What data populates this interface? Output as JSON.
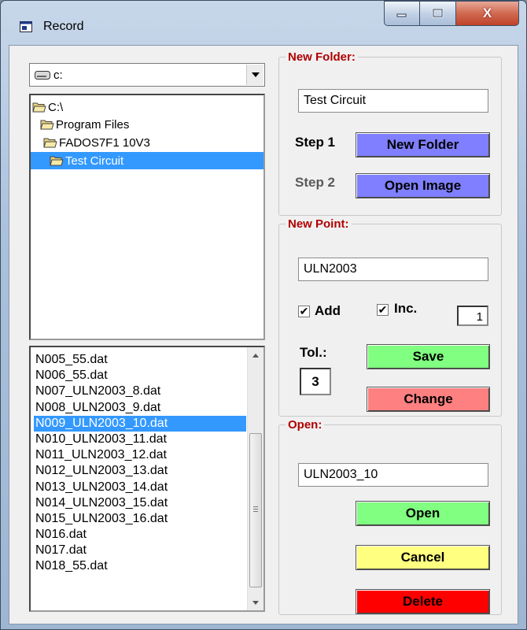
{
  "window": {
    "title": "Record",
    "min_glyph": "–",
    "close_glyph": "X"
  },
  "drive": {
    "value": "c:"
  },
  "tree": {
    "items": [
      "C:\\",
      "Program Files",
      "FADOS7F1 10V3",
      "Test Circuit"
    ],
    "selected": "Test Circuit"
  },
  "files": {
    "items": [
      "N005_55.dat",
      "N006_55.dat",
      "N007_ULN2003_8.dat",
      "N008_ULN2003_9.dat",
      "N009_ULN2003_10.dat",
      "N010_ULN2003_11.dat",
      "N011_ULN2003_12.dat",
      "N012_ULN2003_13.dat",
      "N013_ULN2003_14.dat",
      "N014_ULN2003_15.dat",
      "N015_ULN2003_16.dat",
      "N016.dat",
      "N017.dat",
      "N018_55.dat"
    ],
    "selected": "N009_ULN2003_10.dat"
  },
  "new_folder": {
    "legend": "New Folder:",
    "name_value": "Test Circuit",
    "step1_label": "Step 1",
    "step1_button": "New Folder",
    "step2_label": "Step 2",
    "step2_button": "Open Image"
  },
  "new_point": {
    "legend": "New Point:",
    "name_value": "ULN2003",
    "add_label": "Add",
    "add_checked": true,
    "inc_label": "Inc.",
    "inc_checked": true,
    "inc_value": "1",
    "tol_label": "Tol.:",
    "tol_value": "3",
    "save_button": "Save",
    "change_button": "Change",
    "check_glyph": "✔"
  },
  "open": {
    "legend": "Open:",
    "name_value": "ULN2003_10",
    "open_button": "Open",
    "cancel_button": "Cancel",
    "delete_button": "Delete"
  },
  "colors": {
    "blue_button": "#7f7fff",
    "green_button": "#80ff80",
    "red_button": "#ff8080",
    "yellow_button": "#ffff80",
    "delete_button": "#ff0000",
    "legend": "#b00000",
    "selection": "#3399ff"
  }
}
